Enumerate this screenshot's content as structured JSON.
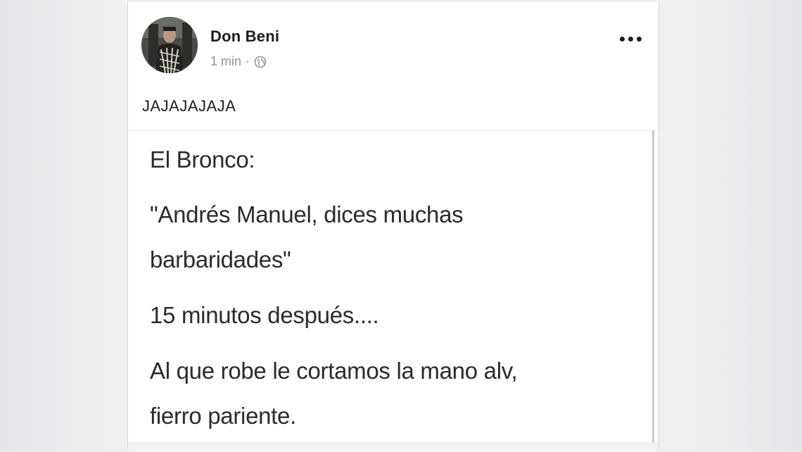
{
  "post": {
    "author": "Don Beni",
    "timestamp": "1 min",
    "separator": "·",
    "privacy_icon": "globe-icon",
    "more_icon": "more-horizontal-icon",
    "text": "JAJAJAJAJA"
  },
  "shared_image": {
    "lines": [
      "El Bronco:",
      "\"Andrés Manuel, dices muchas",
      "barbaridades\"",
      "15 minutos después....",
      "Al que robe le cortamos la mano alv,",
      "fierro pariente."
    ]
  },
  "colors": {
    "background": "#e9ebee",
    "card": "#ffffff",
    "name_text": "#1c1e21",
    "meta_text": "#8d949e"
  }
}
